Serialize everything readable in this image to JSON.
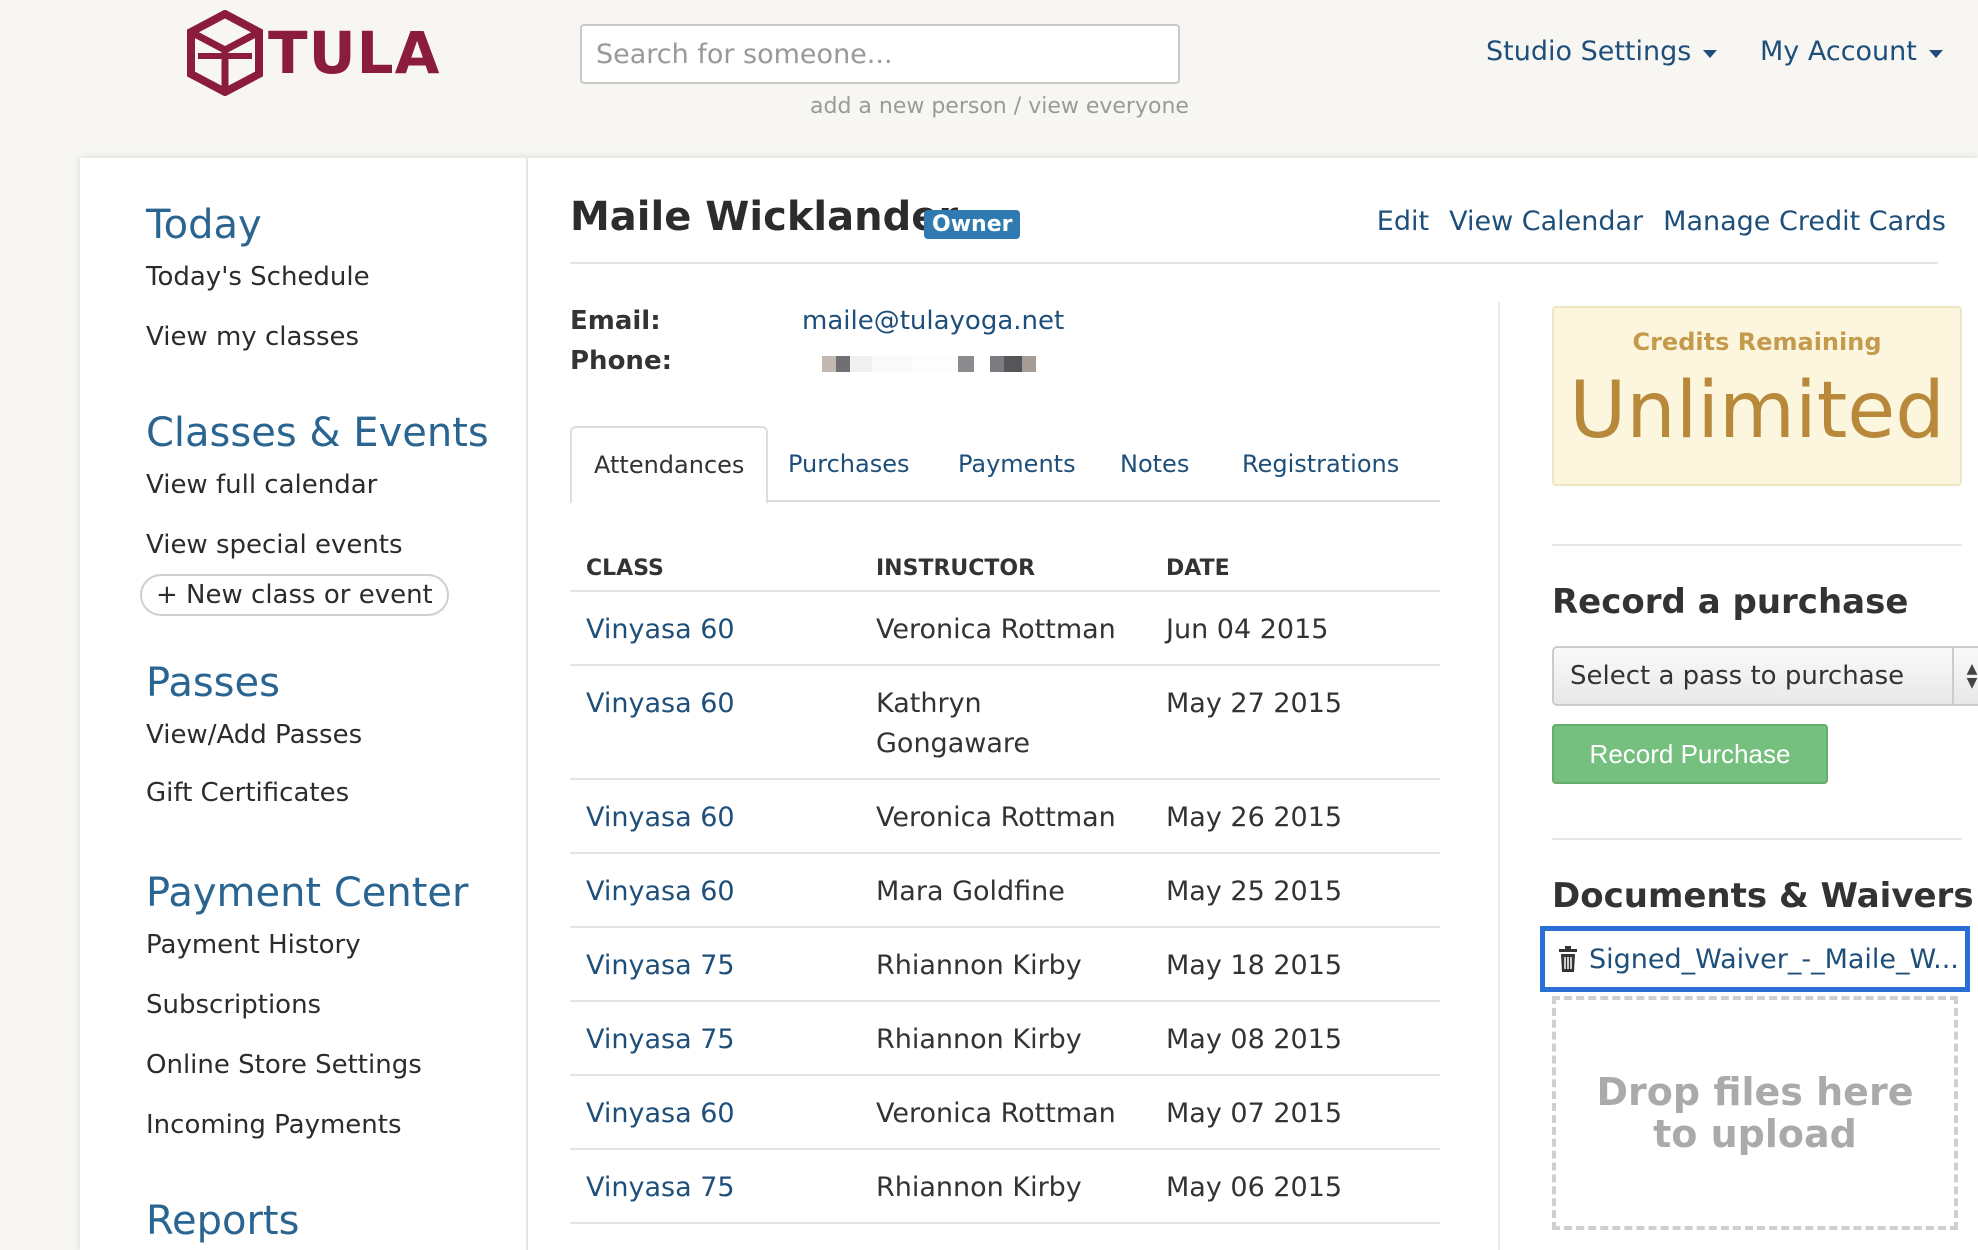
{
  "header": {
    "logo_text": "TULA",
    "search": {
      "placeholder": "Search for someone..."
    },
    "search_links": {
      "add": "add a new person",
      "separator": "/",
      "view": "view everyone"
    },
    "menus": [
      {
        "label": "Studio Settings"
      },
      {
        "label": "My Account"
      }
    ]
  },
  "sidebar": {
    "today": {
      "heading": "Today",
      "links": [
        "Today's Schedule",
        "View my classes"
      ]
    },
    "classes": {
      "heading": "Classes & Events",
      "links": [
        "View full calendar",
        "View special events"
      ],
      "new_button": "+ New class or event"
    },
    "passes": {
      "heading": "Passes",
      "links": [
        "View/Add Passes",
        "Gift Certificates"
      ]
    },
    "payment": {
      "heading": "Payment Center",
      "links": [
        "Payment History",
        "Subscriptions",
        "Online Store Settings",
        "Incoming Payments"
      ]
    },
    "reports": {
      "heading": "Reports"
    }
  },
  "person": {
    "name": "Maile Wicklander",
    "badge": "Owner",
    "actions": [
      "Edit",
      "View Calendar",
      "Manage Credit Cards"
    ],
    "email_label": "Email:",
    "email": "maile@tulayoga.net",
    "phone_label": "Phone:"
  },
  "tabs": [
    {
      "label": "Attendances",
      "active": true
    },
    {
      "label": "Purchases"
    },
    {
      "label": "Payments"
    },
    {
      "label": "Notes"
    },
    {
      "label": "Registrations"
    }
  ],
  "attendances": {
    "columns": [
      "CLASS",
      "INSTRUCTOR",
      "DATE"
    ],
    "rows": [
      {
        "class": "Vinyasa 60",
        "instructor": "Veronica Rottman",
        "date": "Jun 04 2015"
      },
      {
        "class": "Vinyasa 60",
        "instructor": "Kathryn Gongaware",
        "date": "May 27 2015"
      },
      {
        "class": "Vinyasa 60",
        "instructor": "Veronica Rottman",
        "date": "May 26 2015"
      },
      {
        "class": "Vinyasa 60",
        "instructor": "Mara Goldfine",
        "date": "May 25 2015"
      },
      {
        "class": "Vinyasa 75",
        "instructor": "Rhiannon Kirby",
        "date": "May 18 2015"
      },
      {
        "class": "Vinyasa 75",
        "instructor": "Rhiannon Kirby",
        "date": "May 08 2015"
      },
      {
        "class": "Vinyasa 60",
        "instructor": "Veronica Rottman",
        "date": "May 07 2015"
      },
      {
        "class": "Vinyasa 75",
        "instructor": "Rhiannon Kirby",
        "date": "May 06 2015"
      }
    ]
  },
  "credits": {
    "title": "Credits Remaining",
    "value": "Unlimited"
  },
  "purchase": {
    "heading": "Record a purchase",
    "select_value": "Select a pass to purchase",
    "button": "Record Purchase"
  },
  "documents": {
    "heading": "Documents & Waivers",
    "file": "Signed_Waiver_-_Maile_W...",
    "dropzone_line1": "Drop files here",
    "dropzone_line2": "to upload"
  },
  "colors": {
    "brand": "#8b1c3c",
    "link": "#1e4f7a",
    "heading_blue": "#2a6592",
    "badge": "#2f7ab0",
    "success": "#76c07f",
    "credits_gold": "#b8893a",
    "highlight": "#2a6fd6"
  }
}
